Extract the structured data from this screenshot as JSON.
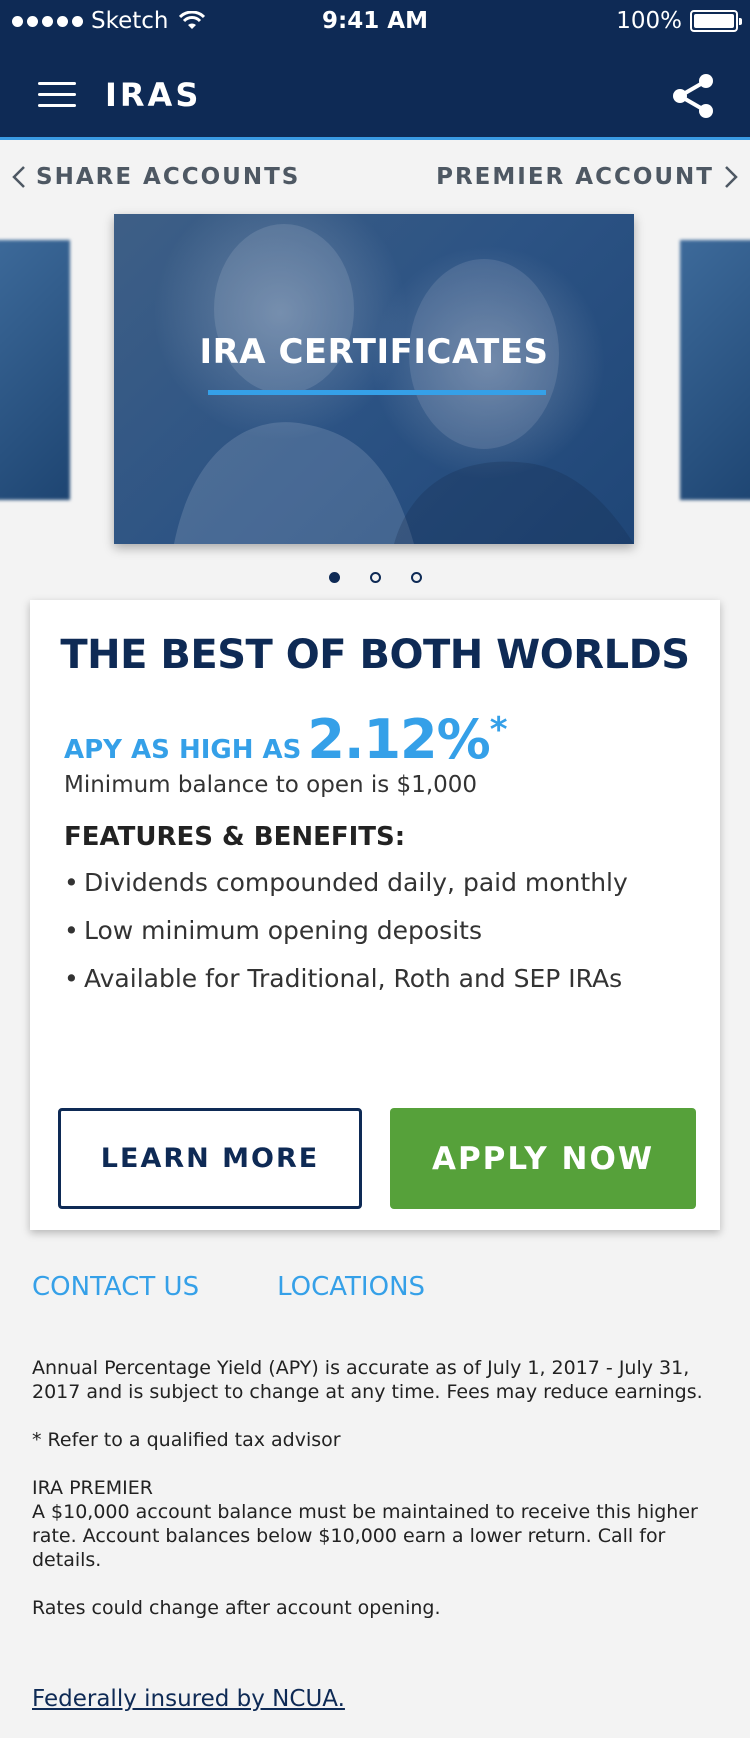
{
  "status_bar": {
    "carrier": "Sketch",
    "time": "9:41 AM",
    "battery": "100%"
  },
  "header": {
    "title": "IRAS",
    "menu_icon": "hamburger-menu-icon",
    "share_icon": "share-icon"
  },
  "carousel": {
    "prev_label": "SHARE ACCOUNTS",
    "next_label": "PREMIER ACCOUNT",
    "current_title": "IRA CERTIFICATES",
    "page_count": 3,
    "active_page": 1
  },
  "card": {
    "heading": "THE BEST OF BOTH WORLDS",
    "apy_label": "APY AS HIGH AS",
    "apy_value": "2.12%",
    "apy_marker": "*",
    "min_balance": "Minimum balance to open is $1,000",
    "features_heading": "FEATURES & BENEFITS:",
    "features": [
      "Dividends compounded daily, paid monthly",
      "Low minimum opening deposits",
      "Available for Traditional, Roth and SEP IRAs"
    ],
    "learn_more_label": "LEARN MORE",
    "apply_now_label": "APPLY NOW"
  },
  "links": {
    "contact": "CONTACT US",
    "locations": "LOCATIONS"
  },
  "disclaimer": {
    "apy_note": "Annual Percentage Yield (APY) is accurate as of July 1, 2017 - July 31, 2017 and is subject to change at any time. Fees may reduce earnings.",
    "tax_note": "* Refer to a qualified tax advisor",
    "premier_title": "IRA PREMIER",
    "premier_note": "A $10,000 account balance must be maintained to receive this higher rate. Account balances below $10,000 earn a lower return. Call for details.",
    "rates_note": "Rates could change after account opening."
  },
  "footer": {
    "ncua": "Federally insured by NCUA."
  },
  "colors": {
    "navy": "#0e2a55",
    "accent_blue": "#35a0e8",
    "apply_green": "#56a13a"
  }
}
